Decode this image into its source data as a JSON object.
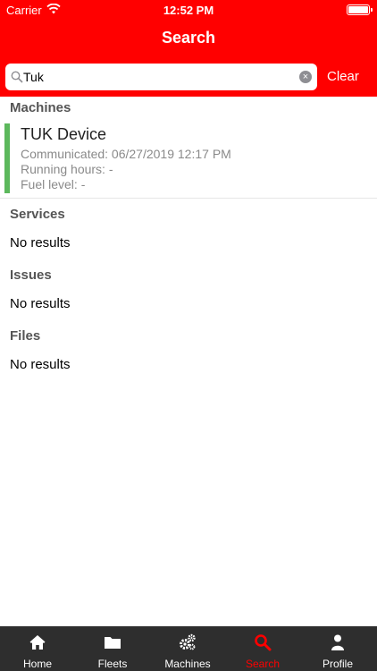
{
  "status_bar": {
    "carrier": "Carrier",
    "time": "12:52 PM"
  },
  "nav": {
    "title": "Search"
  },
  "search": {
    "value": "Tuk",
    "clear_label": "Clear"
  },
  "sections": {
    "machines": {
      "title": "Machines",
      "items": [
        {
          "name": "TUK Device",
          "communicated": "Communicated: 06/27/2019 12:17 PM",
          "running_hours": "Running hours: -",
          "fuel_level": "Fuel level: -",
          "status_color": "#5cb85c"
        }
      ]
    },
    "services": {
      "title": "Services",
      "empty": "No results"
    },
    "issues": {
      "title": "Issues",
      "empty": "No results"
    },
    "files": {
      "title": "Files",
      "empty": "No results"
    }
  },
  "tabs": [
    {
      "label": "Home",
      "icon": "home-icon"
    },
    {
      "label": "Fleets",
      "icon": "folder-icon"
    },
    {
      "label": "Machines",
      "icon": "gears-icon"
    },
    {
      "label": "Search",
      "icon": "search-icon",
      "active": true
    },
    {
      "label": "Profile",
      "icon": "user-icon"
    }
  ],
  "colors": {
    "brand": "#ff0000",
    "tab_bar": "#2e2e2e",
    "ok": "#5cb85c"
  }
}
